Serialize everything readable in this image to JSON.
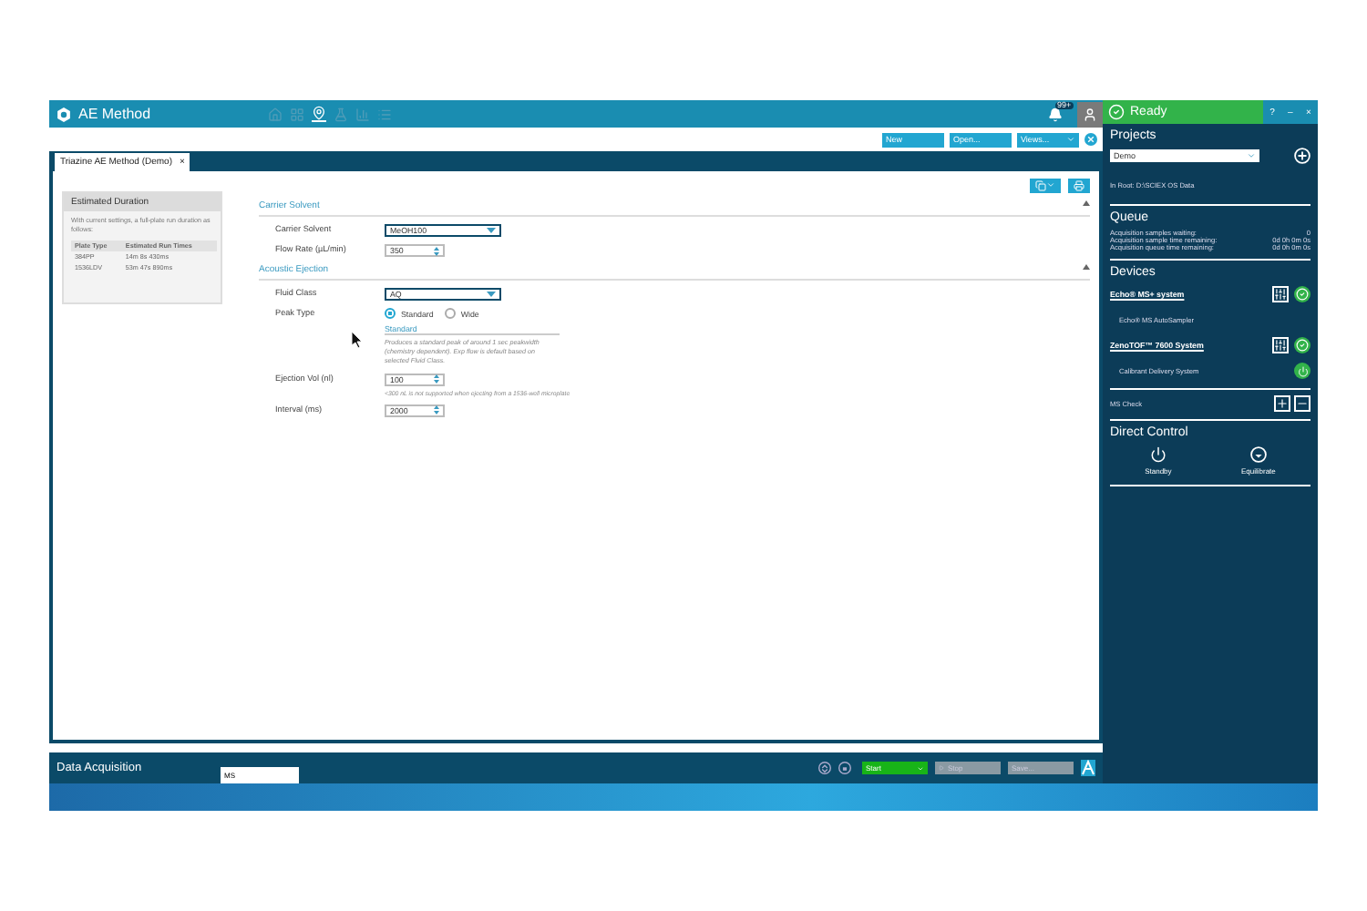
{
  "app": {
    "title": "AE Method",
    "notifications": "99+",
    "nav_icons": [
      {
        "kind": "home",
        "selected": false
      },
      {
        "kind": "grid",
        "selected": false
      },
      {
        "kind": "pin",
        "selected": true
      },
      {
        "kind": "flask",
        "selected": false
      },
      {
        "kind": "chart",
        "selected": false
      },
      {
        "kind": "list",
        "selected": false
      }
    ]
  },
  "toolbar": {
    "buttons": [
      {
        "label": "New",
        "kind": "plain"
      },
      {
        "label": "Open...",
        "kind": "plain"
      },
      {
        "label": "Views...",
        "kind": "dropdown"
      }
    ]
  },
  "tabs": [
    {
      "label": "Triazine AE Method (Demo)",
      "close": "×",
      "selected": true
    }
  ],
  "estimate": {
    "title": "Estimated Duration",
    "text": "With current settings, a full-plate run duration as follows:",
    "columns": [
      "Plate Type",
      "Estimated Run Times"
    ],
    "rows": [
      [
        "384PP",
        "14m 8s 430ms"
      ],
      [
        "1536LDV",
        "53m 47s 890ms"
      ]
    ]
  },
  "sections": [
    {
      "title": "Carrier Solvent",
      "fields": [
        {
          "kind": "select",
          "label": "Carrier Solvent",
          "value": "MeOH100"
        },
        {
          "kind": "spin",
          "label": "Flow Rate (µL/min)",
          "value": "350"
        }
      ]
    },
    {
      "title": "Acoustic Ejection",
      "fields": [
        {
          "kind": "select",
          "label": "Fluid Class",
          "value": "AQ"
        },
        {
          "kind": "radio",
          "label": "Peak Type",
          "options": [
            {
              "label": "Standard",
              "selected": true
            },
            {
              "label": "Wide",
              "selected": false
            }
          ],
          "heading": "Standard",
          "note": "Produces a standard peak of around 1 sec peakwidth (chemistry dependent). Exp flow is default based on selected Fluid Class."
        },
        {
          "kind": "spin",
          "label": "Ejection Vol (nl)",
          "value": "100",
          "note": "<300 nL is not supported when ejecting from a 1536-well microplate"
        },
        {
          "kind": "spin",
          "label": "Interval (ms)",
          "value": "2000"
        }
      ]
    }
  ],
  "bottom": {
    "title": "Data Acquisition",
    "field": "MS",
    "start": "Start",
    "stop": "Stop",
    "save": "Save..."
  },
  "status": {
    "label": "Ready",
    "controls": [
      "?",
      "–",
      "×"
    ]
  },
  "projects": {
    "title": "Projects",
    "project": "Demo",
    "root": "In Root: D:\\SCIEX OS Data"
  },
  "queue": {
    "title": "Queue",
    "rows": [
      [
        "Acquisition samples waiting:",
        "0"
      ],
      [
        "Acquisition sample time remaining:",
        "0d 0h 0m 0s"
      ],
      [
        "Acquisition queue time remaining:",
        "0d 0h 0m 0s"
      ]
    ]
  },
  "devices": {
    "title": "Devices",
    "items": [
      {
        "name": "Echo® MS+ system",
        "sub": "Echo® MS AutoSampler",
        "kind": "plain"
      },
      {
        "name": "ZenoTOF™ 7600 System",
        "sub": "Calibrant Delivery System",
        "kind": "power"
      }
    ]
  },
  "ms_check": "MS Check",
  "direct_control": {
    "title": "Direct Control",
    "actions": [
      {
        "label": "Standby",
        "kind": "power"
      },
      {
        "label": "Equilibrate",
        "kind": "equilibrate"
      }
    ]
  }
}
